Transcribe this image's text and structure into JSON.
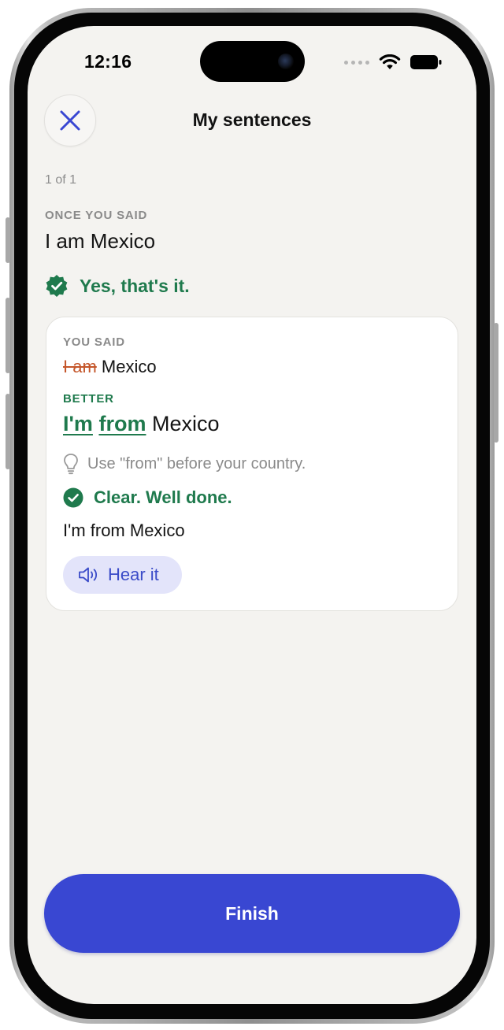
{
  "status_bar": {
    "time": "12:16"
  },
  "header": {
    "title": "My sentences",
    "close_icon": "close-x-icon"
  },
  "progress": {
    "counter": "1 of 1"
  },
  "original": {
    "label": "ONCE YOU SAID",
    "sentence": "I am Mexico"
  },
  "confirmation": {
    "icon": "verified-badge-icon",
    "text": "Yes, that's it."
  },
  "card": {
    "you_said_label": "YOU SAID",
    "you_said_removed": "I am",
    "you_said_rest": " Mexico",
    "better_label": "BETTER",
    "better_word_1": "I'm",
    "better_word_2": "from",
    "better_rest": " Mexico",
    "tip_icon": "lightbulb-icon",
    "tip": "Use \"from\" before your country.",
    "result_icon": "check-circle-icon",
    "result": "Clear. Well done.",
    "final_sentence": "I'm from Mexico",
    "hear_button": {
      "icon": "speaker-icon",
      "label": "Hear it"
    }
  },
  "footer": {
    "finish_label": "Finish"
  },
  "colors": {
    "background": "#f4f3f0",
    "success_green": "#1f7a4d",
    "correction_red": "#c4562a",
    "primary_blue": "#3947d2",
    "hear_bg": "#e3e4fa"
  }
}
